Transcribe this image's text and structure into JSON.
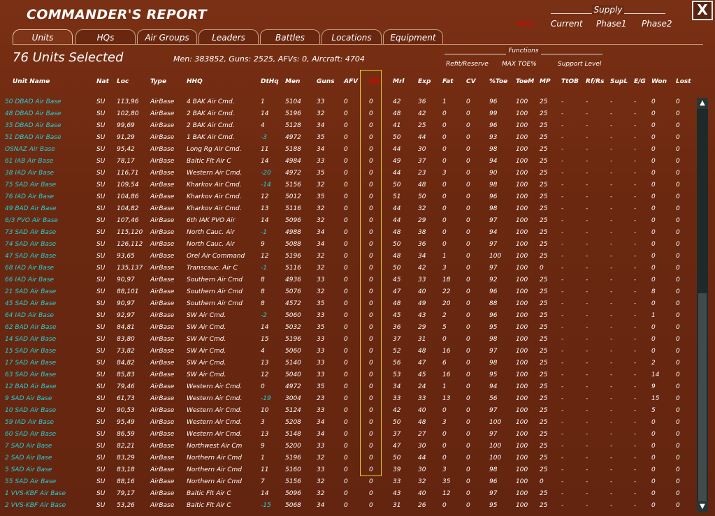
{
  "title": "COMMANDER'S REPORT",
  "close_label": "X",
  "supply": {
    "header": "Supply",
    "month": "May?",
    "current": "Current",
    "phase1": "Phase1",
    "phase2": "Phase2"
  },
  "tabs": [
    "Units",
    "HQs",
    "Air Groups",
    "Leaders",
    "Battles",
    "Locations",
    "Equipment"
  ],
  "active_tab": "Units",
  "selected": "76 Units Selected",
  "summary": "Men: 383852, Guns: 2525, AFVs: 0, Aircraft: 4704",
  "functions": {
    "header": "Functions",
    "refit": "Refit/Reserve",
    "maxtoe": "MAX TOE%",
    "support": "Support Level"
  },
  "columns": [
    "Unit Name",
    "Nat",
    "Loc",
    "Type",
    "HHQ",
    "DtHq",
    "Men",
    "Guns",
    "AFV",
    "AD",
    "Mrl",
    "Exp",
    "Fat",
    "CV",
    "%Toe",
    "ToeM",
    "MP",
    "TtOB",
    "Rf/Rs",
    "SupL",
    "E/G",
    "Won",
    "Lost"
  ],
  "rows": [
    [
      "50 DBAD Air Base",
      "SU",
      "113,96",
      "AirBase",
      "4 BAK Air Cmd.",
      "1",
      "5104",
      "33",
      "0",
      "0",
      "42",
      "36",
      "1",
      "0",
      "96",
      "100",
      "25",
      "-",
      "-",
      "-",
      "-",
      "0",
      "0"
    ],
    [
      "48 DBAD Air Base",
      "SU",
      "102,80",
      "AirBase",
      "2 BAK Air Cmd.",
      "14",
      "5196",
      "32",
      "0",
      "0",
      "48",
      "42",
      "0",
      "0",
      "99",
      "100",
      "25",
      "-",
      "-",
      "-",
      "-",
      "0",
      "0"
    ],
    [
      "35 DBAD Air Base",
      "SU",
      "99,69",
      "AirBase",
      "2 BAK Air Cmd.",
      "4",
      "5128",
      "34",
      "0",
      "0",
      "41",
      "25",
      "0",
      "0",
      "96",
      "100",
      "25",
      "-",
      "-",
      "-",
      "-",
      "0",
      "0"
    ],
    [
      "51 DBAD Air Base",
      "SU",
      "91,29",
      "AirBase",
      "1 BAK Air Cmd.",
      "-3",
      "4972",
      "35",
      "0",
      "0",
      "50",
      "44",
      "0",
      "0",
      "93",
      "100",
      "25",
      "-",
      "-",
      "-",
      "-",
      "0",
      "0"
    ],
    [
      "OSNAZ Air Base",
      "SU",
      "95,42",
      "AirBase",
      "Long Rg Air Cmd.",
      "11",
      "5188",
      "34",
      "0",
      "0",
      "44",
      "30",
      "0",
      "0",
      "98",
      "100",
      "25",
      "-",
      "-",
      "-",
      "-",
      "0",
      "0"
    ],
    [
      "61 IAB Air Base",
      "SU",
      "78,17",
      "AirBase",
      "Baltic Flt Air C",
      "14",
      "4984",
      "33",
      "0",
      "0",
      "49",
      "37",
      "0",
      "0",
      "94",
      "100",
      "25",
      "-",
      "-",
      "-",
      "-",
      "0",
      "0"
    ],
    [
      "38 IAD Air Base",
      "SU",
      "116,71",
      "AirBase",
      "Western Air Cmd.",
      "-20",
      "4972",
      "35",
      "0",
      "0",
      "44",
      "23",
      "3",
      "0",
      "90",
      "100",
      "25",
      "-",
      "-",
      "-",
      "-",
      "0",
      "0"
    ],
    [
      "75 SAD Air Base",
      "SU",
      "109,54",
      "AirBase",
      "Kharkov Air Cmd.",
      "-14",
      "5156",
      "32",
      "0",
      "0",
      "50",
      "48",
      "0",
      "0",
      "98",
      "100",
      "25",
      "-",
      "-",
      "-",
      "-",
      "0",
      "0"
    ],
    [
      "76 IAD Air Base",
      "SU",
      "104,86",
      "AirBase",
      "Kharkov Air Cmd.",
      "12",
      "5012",
      "35",
      "0",
      "0",
      "51",
      "50",
      "0",
      "0",
      "96",
      "100",
      "25",
      "-",
      "-",
      "-",
      "-",
      "0",
      "0"
    ],
    [
      "49 BAD Air Base",
      "SU",
      "104,82",
      "AirBase",
      "Kharkov Air Cmd.",
      "13",
      "5116",
      "32",
      "0",
      "0",
      "44",
      "32",
      "0",
      "0",
      "98",
      "100",
      "25",
      "-",
      "-",
      "-",
      "-",
      "0",
      "0"
    ],
    [
      "6/3 PVO Air Base",
      "SU",
      "107,46",
      "AirBase",
      "6th IAK PVO Air",
      "14",
      "5096",
      "32",
      "0",
      "0",
      "44",
      "29",
      "0",
      "0",
      "97",
      "100",
      "25",
      "-",
      "-",
      "-",
      "-",
      "0",
      "0"
    ],
    [
      "73 SAD Air Base",
      "SU",
      "115,120",
      "AirBase",
      "North Cauc. Air",
      "-1",
      "4988",
      "34",
      "0",
      "0",
      "48",
      "38",
      "0",
      "0",
      "94",
      "100",
      "25",
      "-",
      "-",
      "-",
      "-",
      "0",
      "0"
    ],
    [
      "74 SAD Air Base",
      "SU",
      "126,112",
      "AirBase",
      "North Cauc. Air",
      "9",
      "5088",
      "34",
      "0",
      "0",
      "50",
      "36",
      "0",
      "0",
      "97",
      "100",
      "25",
      "-",
      "-",
      "-",
      "-",
      "0",
      "0"
    ],
    [
      "47 SAD Air Base",
      "SU",
      "93,65",
      "AirBase",
      "Orel Air Command",
      "12",
      "5196",
      "32",
      "0",
      "0",
      "48",
      "34",
      "1",
      "0",
      "100",
      "100",
      "25",
      "-",
      "-",
      "-",
      "-",
      "0",
      "0"
    ],
    [
      "68 IAD Air Base",
      "SU",
      "135,137",
      "AirBase",
      "Transcauc. Air C",
      "-1",
      "5116",
      "32",
      "0",
      "0",
      "50",
      "42",
      "3",
      "0",
      "97",
      "100",
      "0",
      "-",
      "-",
      "-",
      "-",
      "0",
      "0"
    ],
    [
      "66 IAD Air Base",
      "SU",
      "90,97",
      "AirBase",
      "Southern Air Cmd",
      "8",
      "4936",
      "33",
      "0",
      "0",
      "45",
      "33",
      "18",
      "0",
      "92",
      "100",
      "25",
      "-",
      "-",
      "-",
      "-",
      "0",
      "0"
    ],
    [
      "21 SAD Air Base",
      "SU",
      "88,101",
      "AirBase",
      "Southern Air Cmd",
      "8",
      "5076",
      "32",
      "0",
      "0",
      "47",
      "40",
      "22",
      "0",
      "96",
      "100",
      "25",
      "-",
      "-",
      "-",
      "-",
      "8",
      "0"
    ],
    [
      "45 SAD Air Base",
      "SU",
      "90,97",
      "AirBase",
      "Southern Air Cmd",
      "8",
      "4572",
      "35",
      "0",
      "0",
      "48",
      "49",
      "20",
      "0",
      "88",
      "100",
      "25",
      "-",
      "-",
      "-",
      "-",
      "0",
      "0"
    ],
    [
      "64 IAD Air Base",
      "SU",
      "92,97",
      "AirBase",
      "SW Air Cmd.",
      "-2",
      "5060",
      "33",
      "0",
      "0",
      "45",
      "43",
      "2",
      "0",
      "96",
      "100",
      "25",
      "-",
      "-",
      "-",
      "-",
      "1",
      "0"
    ],
    [
      "62 BAD Air Base",
      "SU",
      "84,81",
      "AirBase",
      "SW Air Cmd.",
      "14",
      "5032",
      "35",
      "0",
      "0",
      "36",
      "29",
      "5",
      "0",
      "95",
      "100",
      "25",
      "-",
      "-",
      "-",
      "-",
      "0",
      "0"
    ],
    [
      "14 SAD Air Base",
      "SU",
      "83,80",
      "AirBase",
      "SW Air Cmd.",
      "15",
      "5196",
      "33",
      "0",
      "0",
      "37",
      "31",
      "0",
      "0",
      "98",
      "100",
      "25",
      "-",
      "-",
      "-",
      "-",
      "0",
      "0"
    ],
    [
      "15 SAD Air Base",
      "SU",
      "73,82",
      "AirBase",
      "SW Air Cmd.",
      "4",
      "5060",
      "33",
      "0",
      "0",
      "52",
      "48",
      "16",
      "0",
      "97",
      "100",
      "25",
      "-",
      "-",
      "-",
      "-",
      "0",
      "0"
    ],
    [
      "17 SAD Air Base",
      "SU",
      "84,82",
      "AirBase",
      "SW Air Cmd.",
      "13",
      "5140",
      "33",
      "0",
      "0",
      "56",
      "47",
      "6",
      "0",
      "98",
      "100",
      "25",
      "-",
      "-",
      "-",
      "-",
      "2",
      "0"
    ],
    [
      "63 SAD Air Base",
      "SU",
      "85,83",
      "AirBase",
      "SW Air Cmd.",
      "12",
      "5040",
      "33",
      "0",
      "0",
      "53",
      "45",
      "16",
      "0",
      "95",
      "100",
      "25",
      "-",
      "-",
      "-",
      "-",
      "14",
      "0"
    ],
    [
      "12 BAD Air Base",
      "SU",
      "79,46",
      "AirBase",
      "Western Air Cmd.",
      "0",
      "4972",
      "35",
      "0",
      "0",
      "34",
      "24",
      "1",
      "0",
      "94",
      "100",
      "25",
      "-",
      "-",
      "-",
      "-",
      "9",
      "0"
    ],
    [
      "9 SAD Air Base",
      "SU",
      "61,73",
      "AirBase",
      "Western Air Cmd.",
      "-19",
      "3004",
      "23",
      "0",
      "0",
      "33",
      "33",
      "13",
      "0",
      "56",
      "100",
      "25",
      "-",
      "-",
      "-",
      "-",
      "15",
      "0"
    ],
    [
      "10 SAD Air Base",
      "SU",
      "90,53",
      "AirBase",
      "Western Air Cmd.",
      "10",
      "5124",
      "33",
      "0",
      "0",
      "42",
      "40",
      "0",
      "0",
      "97",
      "100",
      "25",
      "-",
      "-",
      "-",
      "-",
      "5",
      "0"
    ],
    [
      "59 IAD Air Base",
      "SU",
      "95,49",
      "AirBase",
      "Western Air Cmd.",
      "3",
      "5208",
      "34",
      "0",
      "0",
      "50",
      "48",
      "3",
      "0",
      "100",
      "100",
      "25",
      "-",
      "-",
      "-",
      "-",
      "0",
      "0"
    ],
    [
      "60 SAD Air Base",
      "SU",
      "86,59",
      "AirBase",
      "Western Air Cmd.",
      "13",
      "5148",
      "34",
      "0",
      "0",
      "37",
      "27",
      "0",
      "0",
      "97",
      "100",
      "25",
      "-",
      "-",
      "-",
      "-",
      "0",
      "0"
    ],
    [
      "7 SAD Air Base",
      "SU",
      "82,21",
      "AirBase",
      "Northwest Air Cm",
      "9",
      "5200",
      "33",
      "0",
      "0",
      "47",
      "30",
      "0",
      "0",
      "100",
      "100",
      "25",
      "-",
      "-",
      "-",
      "-",
      "0",
      "0"
    ],
    [
      "2 SAD Air Base",
      "SU",
      "83,29",
      "AirBase",
      "Northern Air Cmd",
      "1",
      "5196",
      "32",
      "0",
      "0",
      "50",
      "44",
      "0",
      "0",
      "100",
      "100",
      "25",
      "-",
      "-",
      "-",
      "-",
      "0",
      "0"
    ],
    [
      "5 SAD Air Base",
      "SU",
      "83,18",
      "AirBase",
      "Northern Air Cmd",
      "11",
      "5160",
      "33",
      "0",
      "0",
      "39",
      "30",
      "3",
      "0",
      "98",
      "100",
      "25",
      "-",
      "-",
      "-",
      "-",
      "0",
      "0"
    ],
    [
      "55 SAD Air Base",
      "SU",
      "88,16",
      "AirBase",
      "Northern Air Cmd",
      "7",
      "5156",
      "32",
      "0",
      "0",
      "33",
      "32",
      "35",
      "0",
      "96",
      "100",
      "0",
      "-",
      "-",
      "-",
      "-",
      "0",
      "0"
    ],
    [
      "1 VVS-KBF Air Base",
      "SU",
      "79,17",
      "AirBase",
      "Baltic Flt Air C",
      "14",
      "5096",
      "32",
      "0",
      "0",
      "43",
      "40",
      "12",
      "0",
      "97",
      "100",
      "25",
      "-",
      "-",
      "-",
      "-",
      "0",
      "0"
    ],
    [
      "2 VVS-KBF Air Base",
      "SU",
      "53,26",
      "AirBase",
      "Baltic Flt Air C",
      "-15",
      "5068",
      "34",
      "0",
      "0",
      "31",
      "26",
      "0",
      "0",
      "95",
      "100",
      "25",
      "-",
      "-",
      "-",
      "-",
      "0",
      "0"
    ]
  ],
  "scroll": {
    "up": "▲",
    "down": "▼"
  }
}
